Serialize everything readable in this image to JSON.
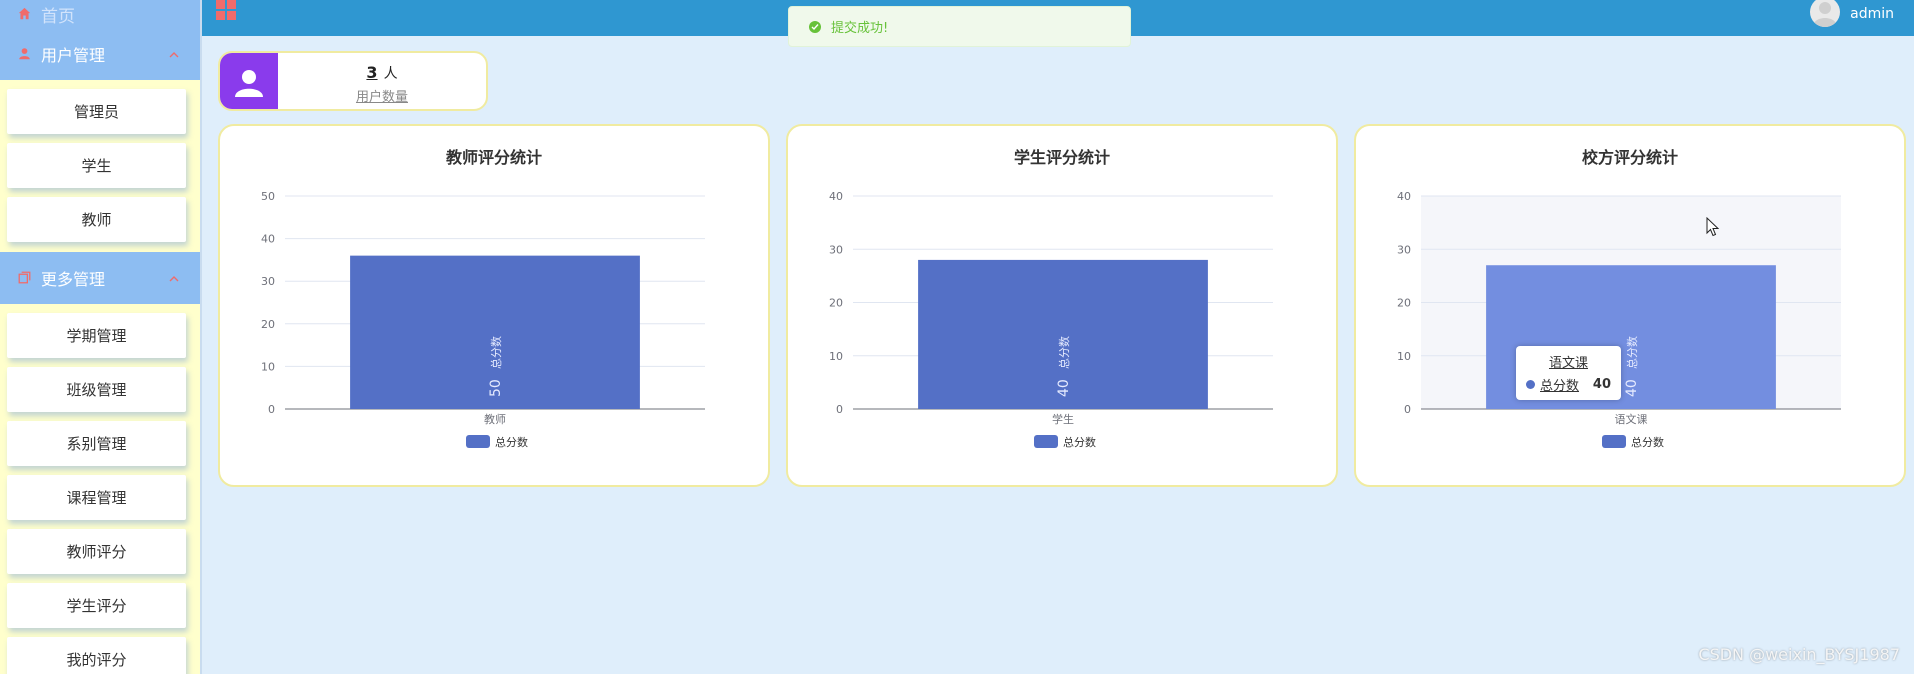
{
  "sidebar": {
    "home_label": "首页",
    "groups": [
      {
        "label": "用户管理",
        "icon": "user-icon",
        "items": [
          "管理员",
          "学生",
          "教师"
        ]
      },
      {
        "label": "更多管理",
        "icon": "copy-icon",
        "items": [
          "学期管理",
          "班级管理",
          "系别管理",
          "课程管理",
          "教师评分",
          "学生评分",
          "我的评分"
        ]
      }
    ]
  },
  "topbar": {
    "username": "admin"
  },
  "toast": {
    "message": "提交成功!"
  },
  "stat": {
    "value": "3",
    "unit": "人",
    "label": "用户数量"
  },
  "colors": {
    "bar": "#5470c6",
    "bar_hover": "#738ee0",
    "accent_purple": "#8a3bec",
    "topbar": "#2f97d1"
  },
  "chart_data": [
    {
      "type": "bar",
      "title": "教师评分统计",
      "categories": [
        "教师"
      ],
      "series": [
        {
          "name": "总分数",
          "values": [
            36
          ],
          "label": "50"
        }
      ],
      "yticks": [
        "0",
        "10",
        "20",
        "30",
        "40",
        "50"
      ],
      "ylim": [
        0,
        50
      ],
      "legend": "bottom"
    },
    {
      "type": "bar",
      "title": "学生评分统计",
      "categories": [
        "学生"
      ],
      "series": [
        {
          "name": "总分数",
          "values": [
            28
          ],
          "label": "40"
        }
      ],
      "yticks": [
        "0",
        "10",
        "20",
        "30",
        "40"
      ],
      "ylim": [
        0,
        40
      ],
      "legend": "bottom"
    },
    {
      "type": "bar",
      "title": "校方评分统计",
      "categories": [
        "语文课"
      ],
      "series": [
        {
          "name": "总分数",
          "values": [
            27
          ],
          "label": "40"
        }
      ],
      "yticks": [
        "0",
        "10",
        "20",
        "30",
        "40"
      ],
      "ylim": [
        0,
        40
      ],
      "legend": "bottom",
      "tooltip": {
        "category": "语文课",
        "series": "总分数",
        "value": "40"
      }
    }
  ],
  "watermark": "CSDN @weixin_BYSJ1987"
}
